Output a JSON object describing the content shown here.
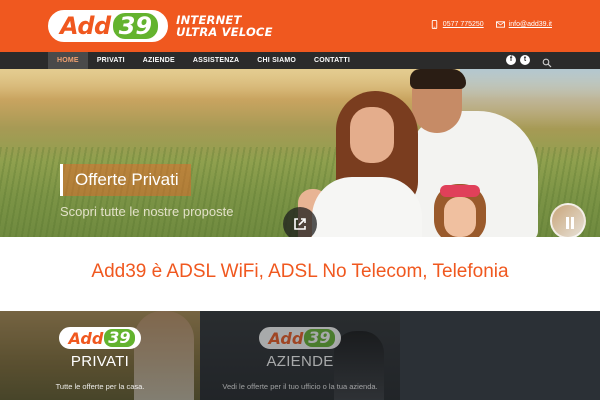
{
  "header": {
    "logo": {
      "word": "Add",
      "number": "39"
    },
    "tagline": {
      "line1": "INTERNET",
      "line2": "ULTRA VELOCE"
    },
    "phone": "0577 775250",
    "email": "info@add39.it",
    "background_color": "#f0581f"
  },
  "nav": {
    "items": [
      {
        "label": "HOME",
        "active": true
      },
      {
        "label": "PRIVATI"
      },
      {
        "label": "AZIENDE"
      },
      {
        "label": "ASSISTENZA"
      },
      {
        "label": "CHI SIAMO"
      },
      {
        "label": "CONTATTI"
      }
    ],
    "social": [
      {
        "icon": "facebook-icon",
        "glyph": "f"
      },
      {
        "icon": "twitter-icon",
        "glyph": "t"
      }
    ],
    "search_icon": "search-icon"
  },
  "hero": {
    "title": "Offerte Privati",
    "subtitle": "Scopri tutte le nostre proposte",
    "link_icon": "external-link-icon",
    "pause_icon": "pause-icon"
  },
  "headline": {
    "text": "Add39 è ADSL WiFi, ADSL No Telecom, Telefonia",
    "color": "#f0581f"
  },
  "cards": [
    {
      "logo_word": "Add",
      "logo_number": "39",
      "title": "PRIVATI",
      "subtitle": "Tutte le offerte per la casa."
    },
    {
      "logo_word": "Add",
      "logo_number": "39",
      "title": "AZIENDE",
      "subtitle": "Vedi le offerte per il tuo ufficio o la tua azienda."
    }
  ],
  "colors": {
    "brand_orange": "#f0581f",
    "brand_green": "#63b32e",
    "nav_bg": "#2b2b2b"
  }
}
